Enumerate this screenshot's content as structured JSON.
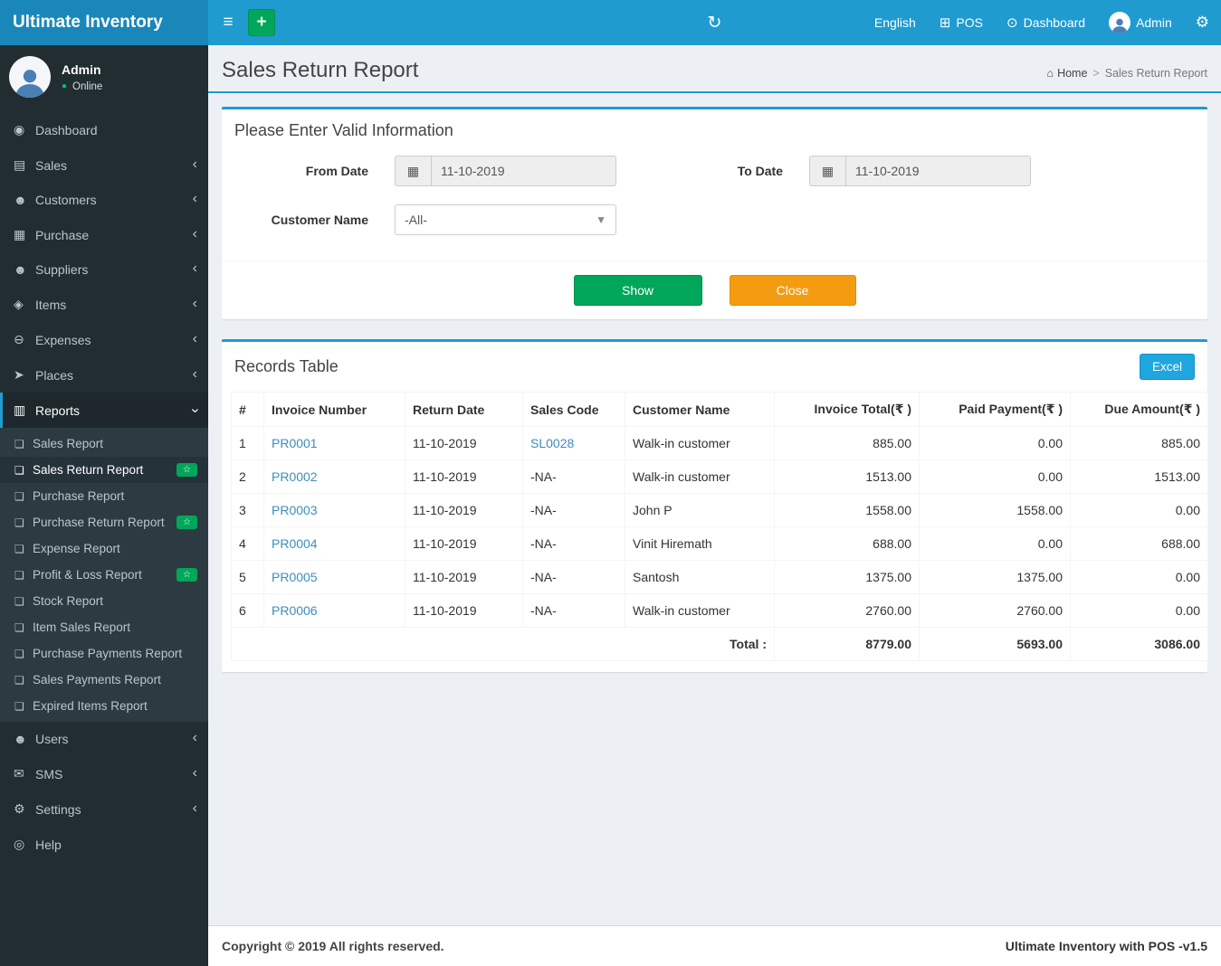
{
  "app": {
    "brand": "Ultimate Inventory"
  },
  "navbar": {
    "language": "English",
    "pos_label": "POS",
    "dashboard_label": "Dashboard",
    "user_label": "Admin",
    "colors": {
      "bar": "#1f9bd0",
      "logo": "#1a87ba"
    }
  },
  "profile": {
    "name": "Admin",
    "status": "Online"
  },
  "sidebar": {
    "items": [
      {
        "id": "dashboard",
        "label": "Dashboard",
        "glyph": "◉"
      },
      {
        "id": "sales",
        "label": "Sales",
        "glyph": "▤",
        "chevron": true
      },
      {
        "id": "customers",
        "label": "Customers",
        "glyph": "☻",
        "chevron": true
      },
      {
        "id": "purchase",
        "label": "Purchase",
        "glyph": "▦",
        "chevron": true
      },
      {
        "id": "suppliers",
        "label": "Suppliers",
        "glyph": "☻",
        "chevron": true
      },
      {
        "id": "items",
        "label": "Items",
        "glyph": "◈",
        "chevron": true
      },
      {
        "id": "expenses",
        "label": "Expenses",
        "glyph": "⊖",
        "chevron": true
      },
      {
        "id": "places",
        "label": "Places",
        "glyph": "➤",
        "chevron": true
      },
      {
        "id": "reports",
        "label": "Reports",
        "glyph": "▥",
        "chevron": true,
        "expanded": true,
        "active": true,
        "children": [
          {
            "id": "sales-report",
            "label": "Sales Report"
          },
          {
            "id": "sales-return-report",
            "label": "Sales Return Report",
            "active": true,
            "badge": true
          },
          {
            "id": "purchase-report",
            "label": "Purchase Report"
          },
          {
            "id": "purchase-return-report",
            "label": "Purchase Return Report",
            "badge": true
          },
          {
            "id": "expense-report",
            "label": "Expense Report"
          },
          {
            "id": "profit-loss-report",
            "label": "Profit & Loss Report",
            "badge": true
          },
          {
            "id": "stock-report",
            "label": "Stock Report"
          },
          {
            "id": "item-sales-report",
            "label": "Item Sales Report"
          },
          {
            "id": "purchase-payments-report",
            "label": "Purchase Payments Report"
          },
          {
            "id": "sales-payments-report",
            "label": "Sales Payments Report"
          },
          {
            "id": "expired-items-report",
            "label": "Expired Items Report"
          }
        ]
      },
      {
        "id": "users",
        "label": "Users",
        "glyph": "☻",
        "chevron": true
      },
      {
        "id": "sms",
        "label": "SMS",
        "glyph": "✉",
        "chevron": true
      },
      {
        "id": "settings",
        "label": "Settings",
        "glyph": "⚙",
        "chevron": true
      },
      {
        "id": "help",
        "label": "Help",
        "glyph": "◎"
      }
    ],
    "badge_glyph": "☆",
    "badge_color": "#00a65a"
  },
  "page": {
    "title": "Sales Return Report",
    "breadcrumb_home": "Home",
    "breadcrumb_separator": ">",
    "breadcrumb_current": "Sales Return Report"
  },
  "filter": {
    "panel_title": "Please Enter Valid Information",
    "from_label": "From Date",
    "from_value": "11-10-2019",
    "to_label": "To Date",
    "to_value": "11-10-2019",
    "customer_label": "Customer Name",
    "customer_value": "-All-",
    "show_label": "Show",
    "close_label": "Close",
    "show_color": "#00a65a",
    "close_color": "#f39c12"
  },
  "records": {
    "panel_title": "Records Table",
    "excel_label": "Excel",
    "excel_color": "#1fa6de",
    "columns": [
      "#",
      "Invoice Number",
      "Return Date",
      "Sales Code",
      "Customer Name",
      "Invoice Total(₹ )",
      "Paid Payment(₹ )",
      "Due Amount(₹ )"
    ],
    "rows": [
      {
        "sn": "1",
        "invoice": "PR0001",
        "return_date": "11-10-2019",
        "sales_code": "SL0028",
        "customer": "Walk-in customer",
        "invoice_total": "885.00",
        "paid": "0.00",
        "due": "885.00"
      },
      {
        "sn": "2",
        "invoice": "PR0002",
        "return_date": "11-10-2019",
        "sales_code": "-NA-",
        "customer": "Walk-in customer",
        "invoice_total": "1513.00",
        "paid": "0.00",
        "due": "1513.00"
      },
      {
        "sn": "3",
        "invoice": "PR0003",
        "return_date": "11-10-2019",
        "sales_code": "-NA-",
        "customer": "John P",
        "invoice_total": "1558.00",
        "paid": "1558.00",
        "due": "0.00"
      },
      {
        "sn": "4",
        "invoice": "PR0004",
        "return_date": "11-10-2019",
        "sales_code": "-NA-",
        "customer": "Vinit Hiremath",
        "invoice_total": "688.00",
        "paid": "0.00",
        "due": "688.00"
      },
      {
        "sn": "5",
        "invoice": "PR0005",
        "return_date": "11-10-2019",
        "sales_code": "-NA-",
        "customer": "Santosh",
        "invoice_total": "1375.00",
        "paid": "1375.00",
        "due": "0.00"
      },
      {
        "sn": "6",
        "invoice": "PR0006",
        "return_date": "11-10-2019",
        "sales_code": "-NA-",
        "customer": "Walk-in customer",
        "invoice_total": "2760.00",
        "paid": "2760.00",
        "due": "0.00"
      }
    ],
    "totals": {
      "label": "Total :",
      "invoice_total": "8779.00",
      "paid": "5693.00",
      "due": "3086.00"
    }
  },
  "footer": {
    "left": "Copyright © 2019 All rights reserved.",
    "right": "Ultimate Inventory with POS -v1.5"
  }
}
